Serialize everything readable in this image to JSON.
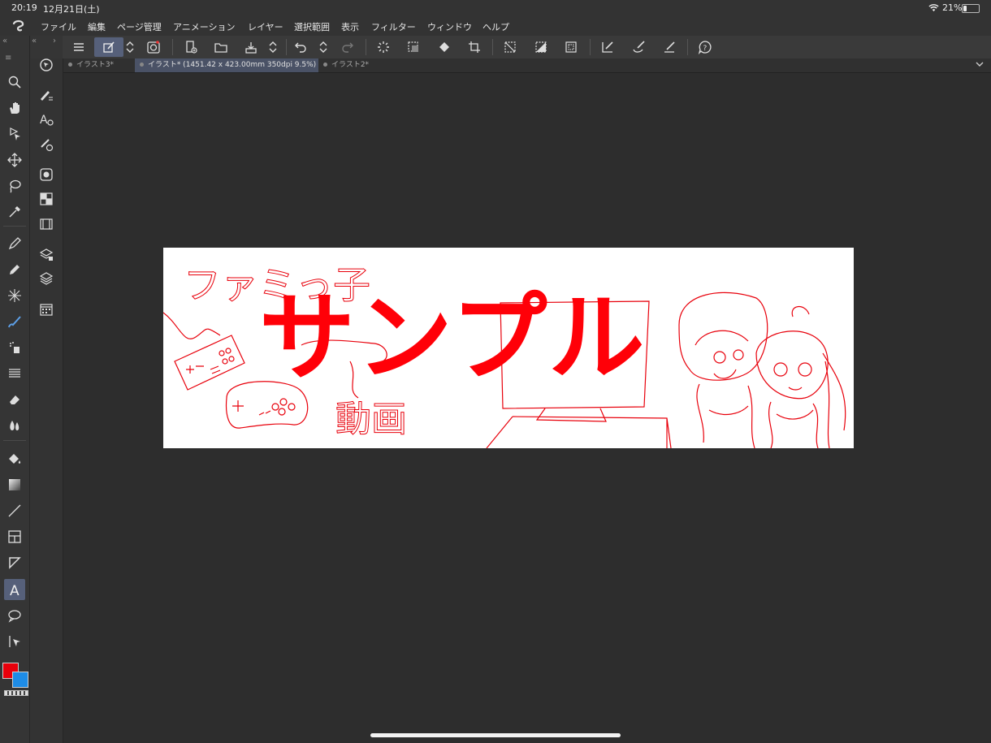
{
  "status": {
    "time": "20:19",
    "date": "12月21日(土)",
    "battery_percent": "21%",
    "battery_level": 0.21
  },
  "menu": {
    "items": [
      "ファイル",
      "編集",
      "ページ管理",
      "アニメーション",
      "レイヤー",
      "選択範囲",
      "表示",
      "フィルター",
      "ウィンドウ",
      "ヘルプ"
    ]
  },
  "tabs": [
    {
      "label": "イラスト3*",
      "active": false
    },
    {
      "label": "イラスト* (1451.42 x 423.00mm 350dpi 9.5%)",
      "active": true
    },
    {
      "label": "イラスト2*",
      "active": false
    }
  ],
  "canvas": {
    "title_text": "サンプル",
    "handwritten_top": "ファミっ子",
    "handwritten_bottom": "動画"
  },
  "colors": {
    "main_color": "#e8000b",
    "sub_color": "#1e8ce6",
    "accent": "#ff0008"
  }
}
